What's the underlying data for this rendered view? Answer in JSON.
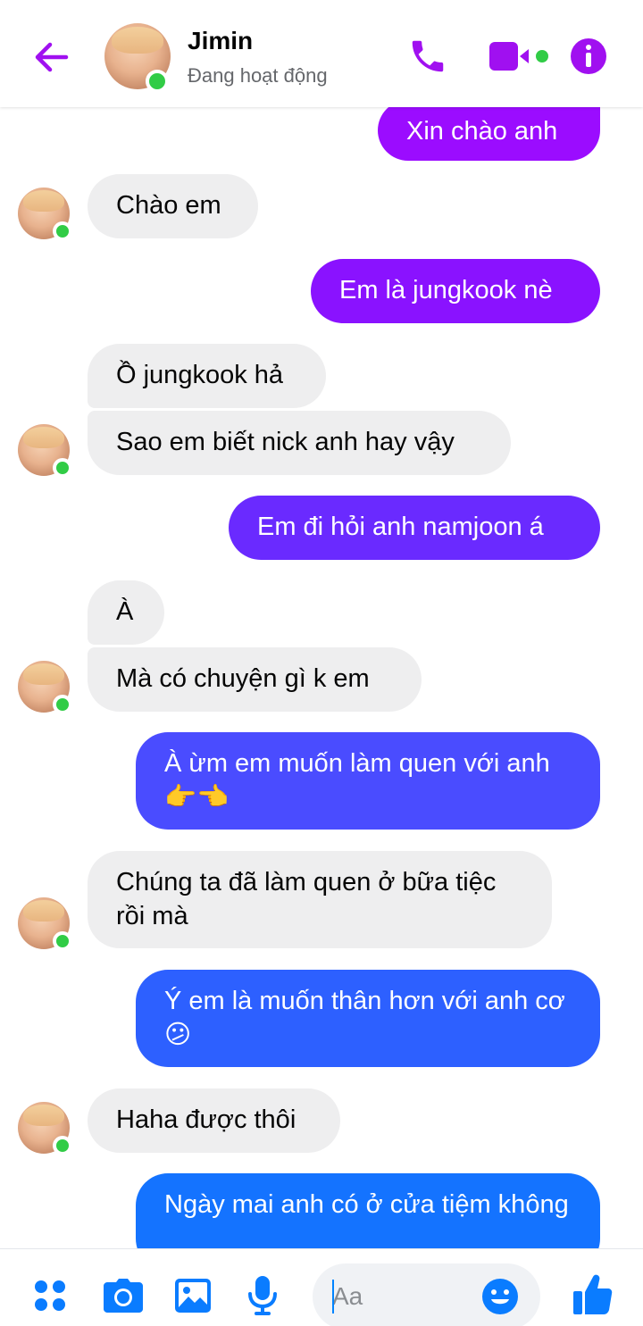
{
  "header": {
    "name": "Jimin",
    "status": "Đang hoạt động",
    "accent": "#9b0cff"
  },
  "messages": [
    {
      "from": "me",
      "text": "Xin chào anh"
    },
    {
      "from": "them",
      "text": "Chào em"
    },
    {
      "from": "me",
      "text": "Em là jungkook nè"
    },
    {
      "from": "them",
      "text": "Ồ jungkook hả"
    },
    {
      "from": "them",
      "text": "Sao em biết nick anh hay vậy"
    },
    {
      "from": "me",
      "text": "Em đi hỏi anh namjoon á"
    },
    {
      "from": "them",
      "text": "À"
    },
    {
      "from": "them",
      "text": "Mà có chuyện gì k em"
    },
    {
      "from": "me",
      "text": "À ừm em muốn làm quen với anh 👉👈"
    },
    {
      "from": "them",
      "text": "Chúng ta đã làm quen ở bữa tiệc rồi mà"
    },
    {
      "from": "me",
      "text": "Ý em là muốn thân hơn với anh cơ😕"
    },
    {
      "from": "them",
      "text": "Haha được thôi"
    },
    {
      "from": "me",
      "text": "Ngày mai anh có ở cửa tiệm không"
    }
  ],
  "composer": {
    "placeholder": "Aa"
  },
  "icons": {
    "back": "arrow-left-icon",
    "call": "phone-icon",
    "video": "video-camera-icon",
    "info": "info-icon",
    "menu": "four-dots-icon",
    "camera": "camera-icon",
    "gallery": "image-icon",
    "mic": "microphone-icon",
    "emoji": "smiley-icon",
    "like": "thumbs-up-icon"
  },
  "colors": {
    "header_icons": "#a010f0",
    "outgoing_gradient": [
      "#9b0cff",
      "#7a1aff",
      "#5a3aff",
      "#3a5cff",
      "#1d6eff",
      "#0d7cff"
    ],
    "incoming_bg": "#eeeeef",
    "online": "#31cc46",
    "toolbar": "#0a7cff"
  }
}
